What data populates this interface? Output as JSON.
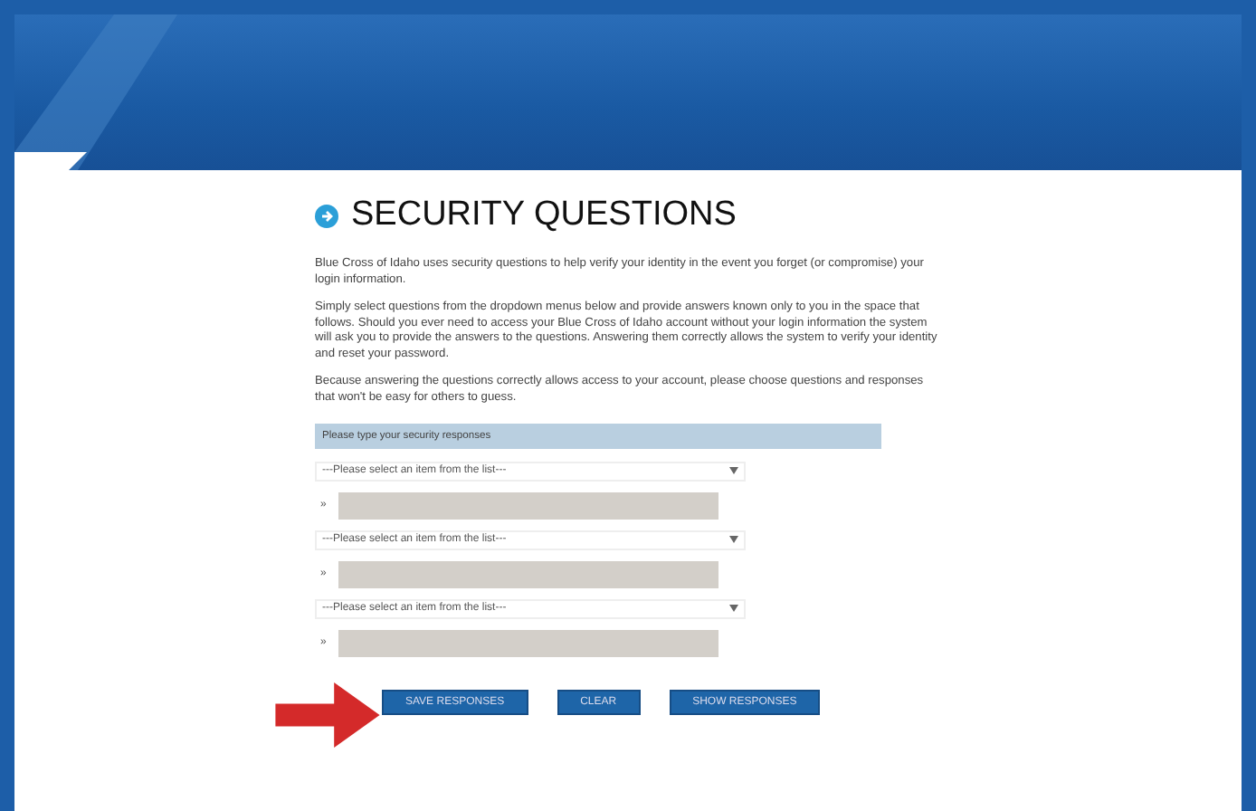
{
  "title": "SECURITY QUESTIONS",
  "paragraphs": [
    "Blue Cross of Idaho uses security questions to help verify your identity in the event you forget (or compromise) your login information.",
    "Simply select questions from the dropdown menus below and provide answers known only to you in the space that follows. Should you ever need to access your Blue Cross of Idaho account without your login information the system will ask you to provide the answers to the questions. Answering them correctly allows the system to verify your identity and reset your password.",
    "Because answering the questions correctly allows access to your account, please choose questions and responses that won't be easy for others to guess."
  ],
  "section_header": "Please type your security responses",
  "questions": [
    {
      "select": "---Please select an item from the list---",
      "marker": "»"
    },
    {
      "select": "---Please select an item from the list---",
      "marker": "»"
    },
    {
      "select": "---Please select an item from the list---",
      "marker": "»"
    }
  ],
  "buttons": [
    "SAVE RESPONSES",
    "CLEAR",
    "SHOW RESPONSES"
  ]
}
